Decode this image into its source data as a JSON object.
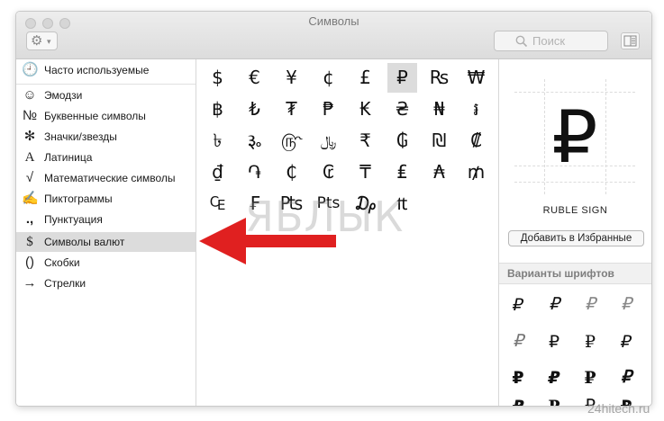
{
  "window": {
    "title": "Символы"
  },
  "toolbar": {
    "gear_icon": "gear-icon",
    "search_placeholder": "Поиск"
  },
  "sidebar": {
    "items": [
      {
        "icon": "🕘",
        "label": "Часто используемые"
      },
      {
        "icon": "☺",
        "label": "Эмодзи"
      },
      {
        "icon": "№",
        "label": "Буквенные символы"
      },
      {
        "icon": "✻",
        "label": "Значки/звезды"
      },
      {
        "icon": "A",
        "label": "Латиница"
      },
      {
        "icon": "√",
        "label": "Математические символы"
      },
      {
        "icon": "✍",
        "label": "Пиктограммы"
      },
      {
        "icon": ".,",
        "label": "Пунктуация"
      },
      {
        "icon": "$",
        "label": "Символы валют"
      },
      {
        "icon": "()",
        "label": "Скобки"
      },
      {
        "icon": "→",
        "label": "Стрелки"
      }
    ],
    "selected": "Символы валют"
  },
  "grid": {
    "rows": [
      [
        "$",
        "€",
        "¥",
        "¢",
        "£",
        "₽",
        "₨",
        "₩"
      ],
      [
        "฿",
        "₺",
        "₮",
        "₱",
        "₭",
        "₴",
        "₦",
        "៛"
      ],
      [
        "৳",
        "૱",
        "௹",
        "﷼",
        "₹",
        "₲",
        "₪",
        "₡"
      ],
      [
        "₫",
        "֏",
        "₵",
        "₢",
        "₸",
        "₤",
        "₳",
        "₥"
      ],
      [
        "₠",
        "₣",
        "₧",
        "Pts",
        "₯",
        "₶"
      ]
    ],
    "selected": "₽"
  },
  "detail": {
    "glyph": "₽",
    "name": "RUBLE SIGN",
    "add_favorites_label": "Добавить в Избранные",
    "variants_title": "Варианты шрифтов",
    "variants": [
      [
        "₽",
        "₽",
        "₽",
        "₽"
      ],
      [
        "₽",
        "₽",
        "₽",
        "₽"
      ],
      [
        "₽",
        "₽",
        "₽",
        "₽"
      ],
      [
        "₽",
        "₽",
        "₽",
        "₽"
      ]
    ]
  },
  "overlay": {
    "watermark": "ЯБЛЫК",
    "site": "24hitech.ru",
    "arrow_color": "#e02020"
  }
}
